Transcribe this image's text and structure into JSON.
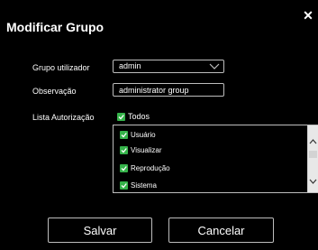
{
  "dialog": {
    "title": "Modificar Grupo",
    "close_glyph": "✕"
  },
  "form": {
    "group_user_label": "Grupo utilizador",
    "group_user_value": "admin",
    "observation_label": "Observação",
    "observation_value": "administrator group",
    "authorization_label": "Lista Autorização",
    "all_label": "Todos",
    "all_checked": true
  },
  "permissions": [
    {
      "label": "Usuário",
      "checked": true
    },
    {
      "label": "Visualizar",
      "checked": true
    },
    {
      "label": "Reprodução",
      "checked": true
    },
    {
      "label": "Sistema",
      "checked": true
    }
  ],
  "actions": {
    "save_label": "Salvar",
    "cancel_label": "Cancelar"
  },
  "colors": {
    "background": "#000000",
    "checkbox": "#35b34a",
    "border": "#bdbdbd"
  },
  "icons": {
    "close": "close-icon",
    "dropdown": "chevron-down-icon",
    "scroll_up": "chevron-up-icon",
    "scroll_down": "chevron-down-icon"
  }
}
